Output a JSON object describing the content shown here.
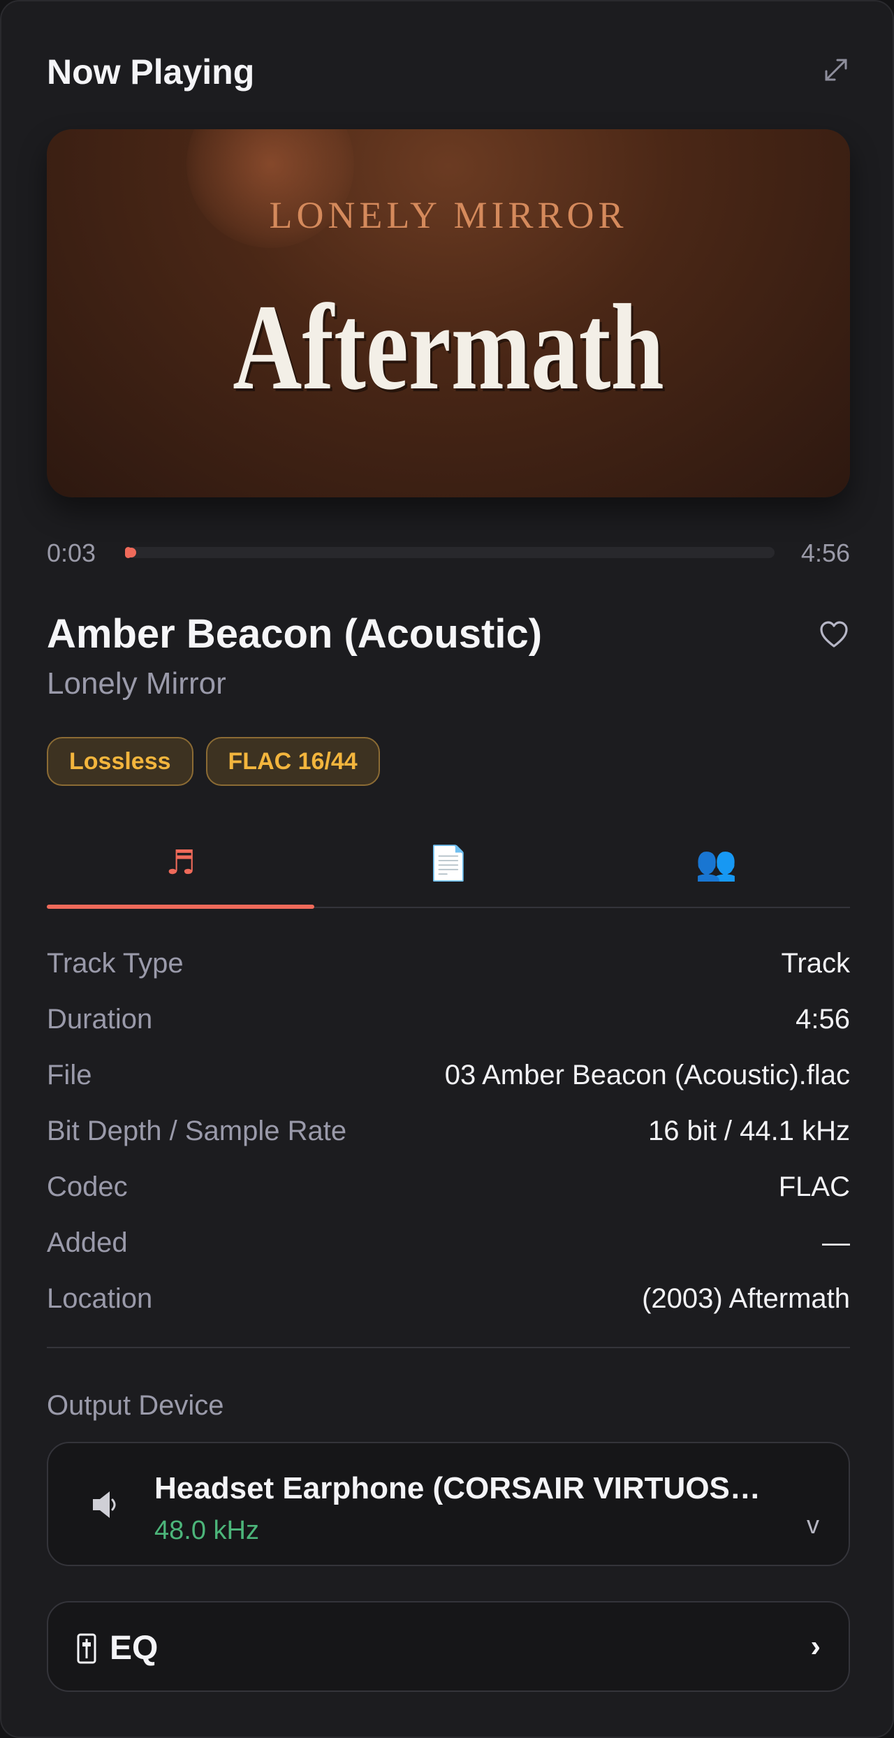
{
  "header": {
    "title": "Now Playing",
    "expand_icon": "expand-icon"
  },
  "cover": {
    "artist_text": "LONELY MIRROR",
    "title_text": "Aftermath"
  },
  "progress": {
    "elapsed": "0:03",
    "total": "4:56",
    "fraction": 0.01,
    "accent": "#ef6a5a"
  },
  "track": {
    "title": "Amber Beacon (Acoustic)",
    "artist": "Lonely Mirror",
    "favorite_icon": "heart-icon"
  },
  "badges": [
    "Lossless",
    "FLAC 16/44"
  ],
  "tabs": [
    {
      "icon": "music-note-icon",
      "glyph": "♬",
      "active": true
    },
    {
      "icon": "document-icon",
      "glyph": "📄",
      "active": false
    },
    {
      "icon": "people-icon",
      "glyph": "👥",
      "active": false
    }
  ],
  "info_rows": [
    {
      "label": "Track Type",
      "value": "Track"
    },
    {
      "label": "Duration",
      "value": "4:56"
    },
    {
      "label": "File",
      "value": "03 Amber Beacon (Acoustic).flac"
    },
    {
      "label": "Bit Depth / Sample Rate",
      "value": "16 bit / 44.1 kHz"
    },
    {
      "label": "Codec",
      "value": "FLAC"
    },
    {
      "label": "Added",
      "value": "—"
    },
    {
      "label": "Location",
      "value": "(2003) Aftermath"
    }
  ],
  "output": {
    "section_label": "Output Device",
    "device_name": "Headset Earphone (CORSAIR VIRTUOSO …",
    "sample_rate": "48.0 kHz",
    "chevron": "v",
    "icon": "speaker-icon"
  },
  "eq": {
    "label": "EQ",
    "chevron": "›",
    "icon": "equalizer-icon"
  },
  "colors": {
    "accent": "#ef6a5a",
    "badge_text": "#f3b53d",
    "rate_green": "#4cb57a"
  }
}
